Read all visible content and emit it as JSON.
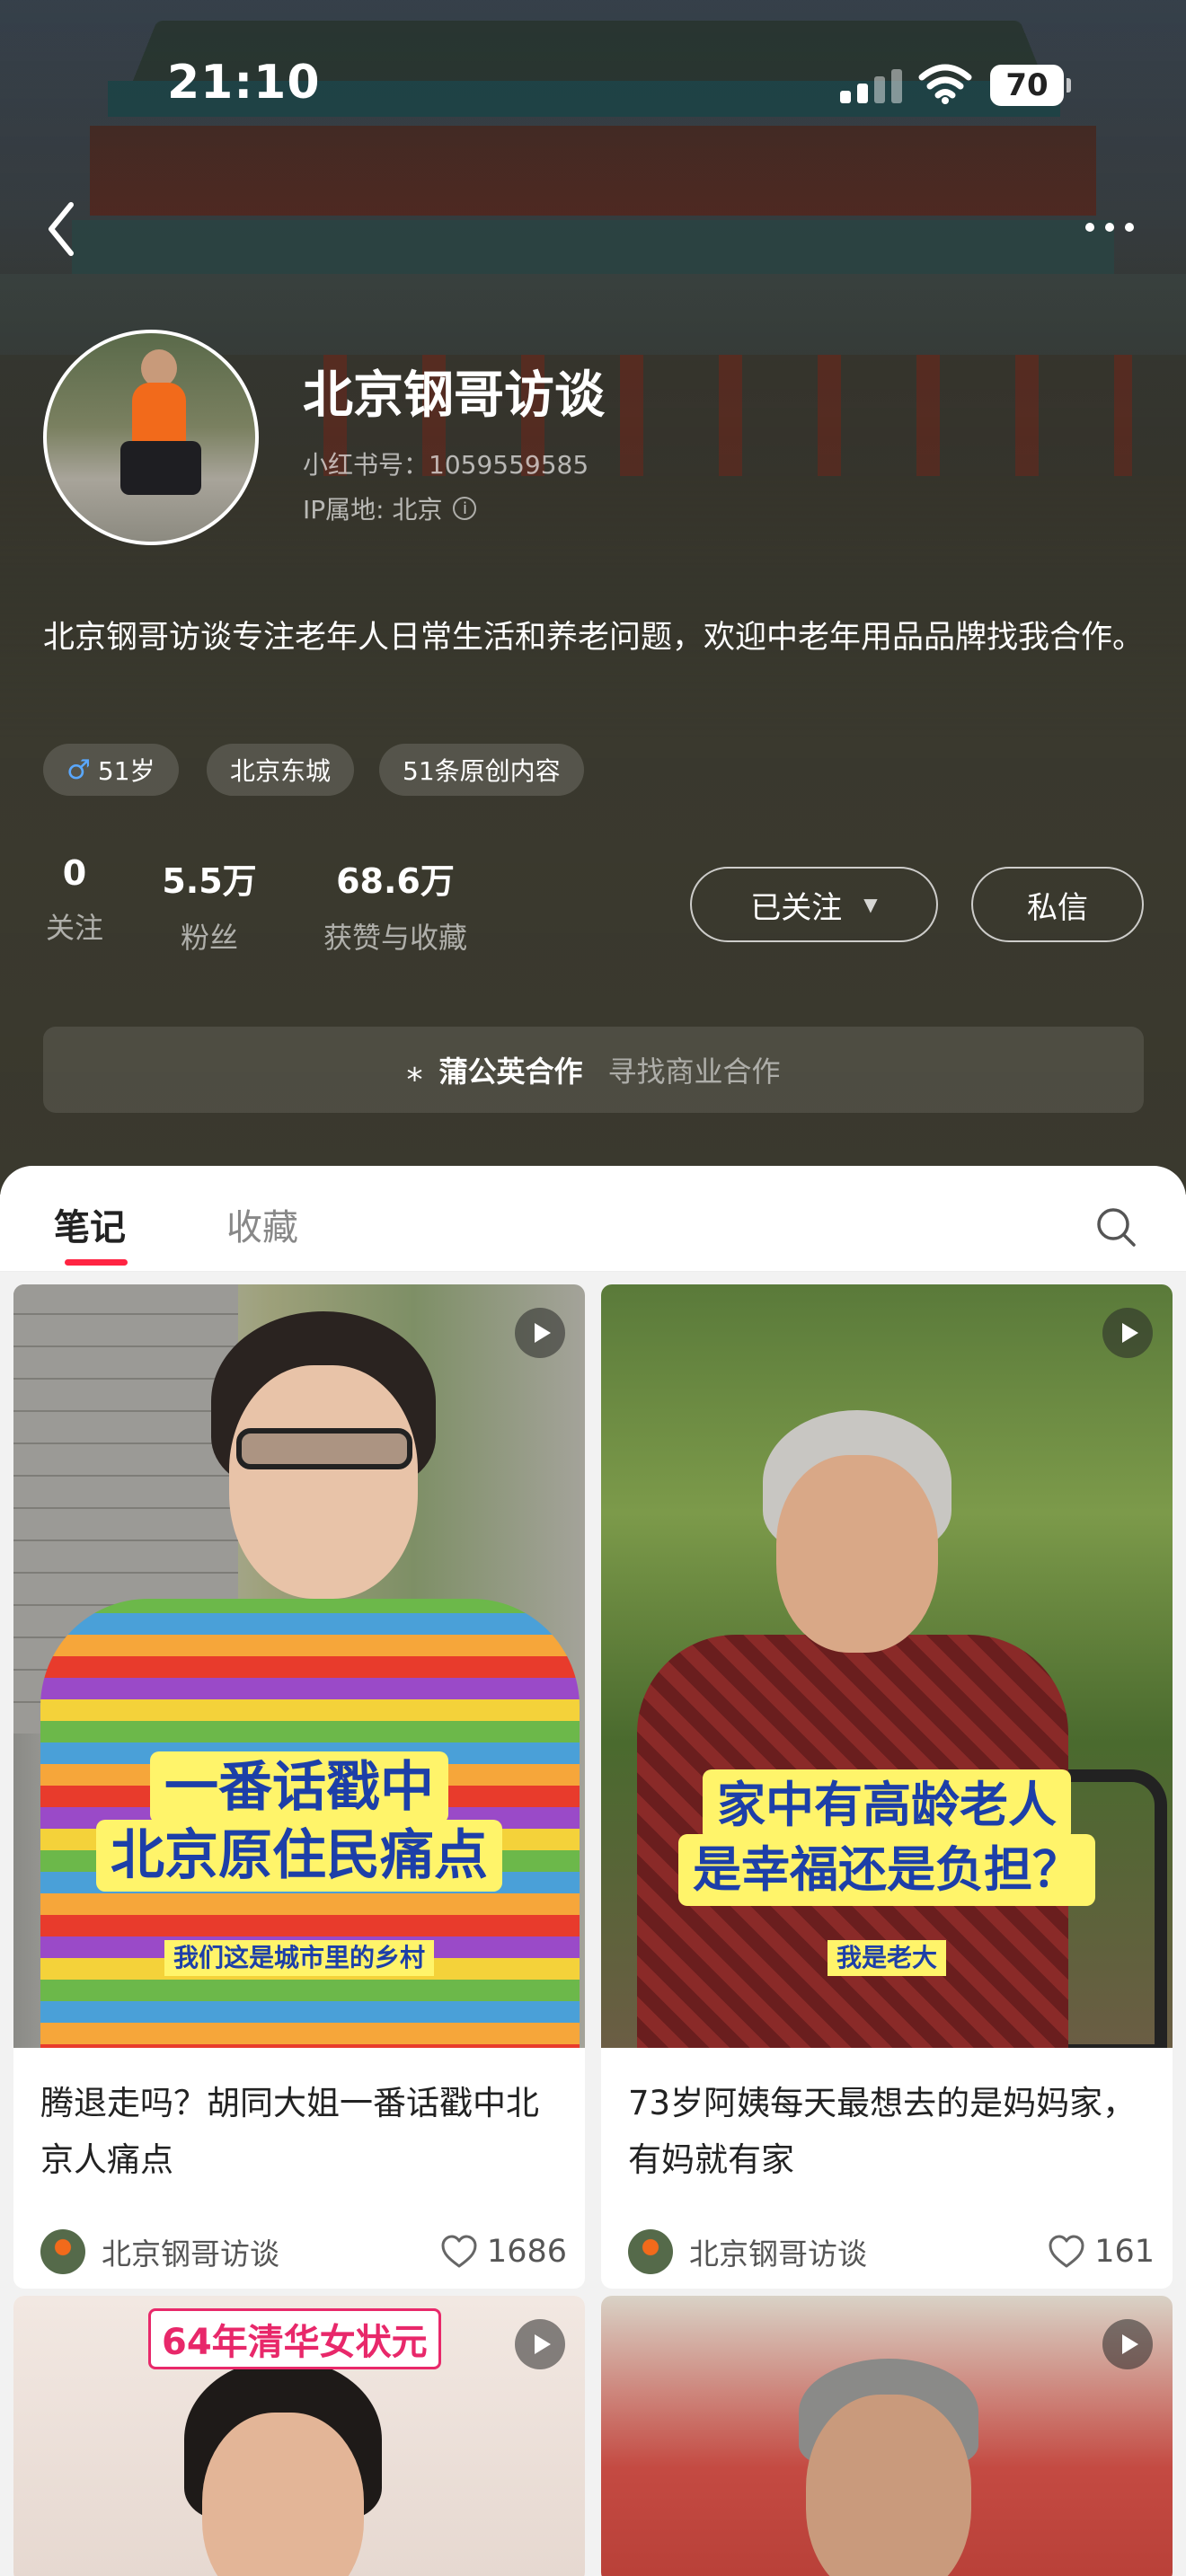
{
  "status_bar": {
    "time": "21:10",
    "battery": "70"
  },
  "profile": {
    "name": "北京钢哥访谈",
    "id_label": "小红书号：1059559585",
    "ip_label": "IP属地: 北京",
    "bio": "北京钢哥访谈专注老年人日常生活和养老问题，欢迎中老年用品品牌找我合作。",
    "tags": {
      "age": "51岁",
      "location": "北京东城",
      "original": "51条原创内容"
    },
    "stats": {
      "following": {
        "value": "0",
        "label": "关注"
      },
      "fans": {
        "value": "5.5万",
        "label": "粉丝"
      },
      "likes": {
        "value": "68.6万",
        "label": "获赞与收藏"
      }
    },
    "follow_button": "已关注",
    "message_button": "私信",
    "business": {
      "title": "蒲公英合作",
      "subtitle": "寻找商业合作"
    }
  },
  "tabs": {
    "notes": "笔记",
    "collect": "收藏"
  },
  "feed": [
    {
      "caption_main_1": "一番话戳中",
      "caption_main_2": "北京原住民痛点",
      "caption_sub": "我们这是城市里的乡村",
      "title": "腾退走吗？胡同大姐一番话戳中北京人痛点",
      "author": "北京钢哥访谈",
      "likes": "1686"
    },
    {
      "caption_main_1": "家中有高龄老人",
      "caption_main_2": "是幸福还是负担？",
      "caption_sub": "我是老大",
      "title": "73岁阿姨每天最想去的是妈妈家，有妈就有家",
      "author": "北京钢哥访谈",
      "likes": "161"
    },
    {
      "caption_main_1": "64年清华女状元"
    },
    {}
  ],
  "colors": {
    "accent": "#ff2442",
    "caption_bg": "#fff46a",
    "caption_text": "#1d3fa8"
  }
}
